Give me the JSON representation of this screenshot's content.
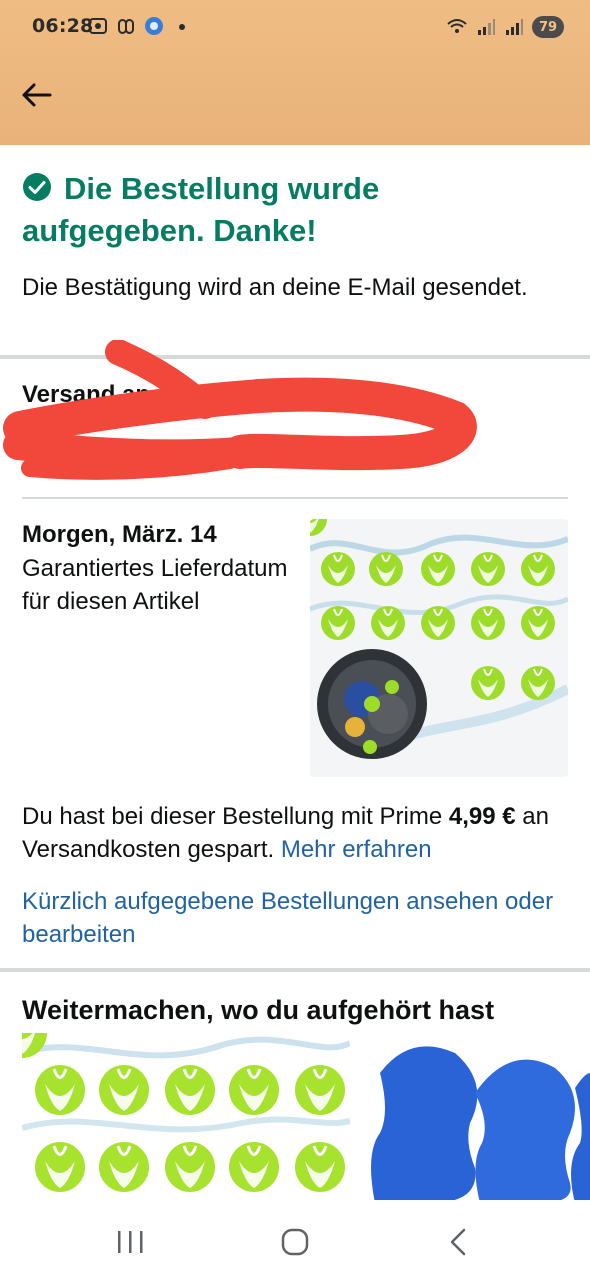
{
  "status_bar": {
    "time": "06:28",
    "battery": "79",
    "left_icons": [
      "screenshot-icon",
      "link-icon",
      "app-icon",
      "dot-icon"
    ],
    "right_icons": [
      "wifi-icon",
      "signal-icon",
      "signal-icon"
    ]
  },
  "header": {
    "back_icon": "arrow-left-icon",
    "accent": "#eab57c"
  },
  "confirmation": {
    "title": "Die Bestellung wurde aufgegeben. Danke!",
    "message": "Die Bestätigung wird an deine E-Mail gesendet.",
    "color": "#067d62"
  },
  "shipping": {
    "label": "Versand an"
  },
  "delivery": {
    "date": "Morgen, März. 14",
    "note": "Garantiertes Lieferdatum für diesen Artikel"
  },
  "prime": {
    "text_before": "Du hast bei dieser Bestellung mit Prime ",
    "amount": "4,99 €",
    "text_after": " an Versandkosten gespart. ",
    "learn_more": "Mehr erfahren"
  },
  "orders_link": "Kürzlich aufgegebene Bestellungen ansehen oder bearbeiten",
  "continue_section": {
    "title": "Weitermachen, wo du aufgehört hast"
  },
  "nav_bar": {
    "icons": [
      "recent-apps-icon",
      "home-icon",
      "back-icon"
    ]
  }
}
